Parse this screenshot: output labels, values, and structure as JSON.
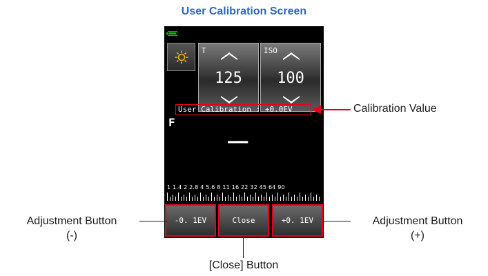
{
  "title": "User Calibration Screen",
  "screen": {
    "param_t": {
      "label": "T",
      "value": "125"
    },
    "param_iso": {
      "label": "ISO",
      "value": "100"
    },
    "calibration_text": "User Calibration : +0.0EV",
    "f_label": "F",
    "reading": "——",
    "f_scale": "1  1.4  2  2.8  4  5.6  8  11  16  22  32  45  64  90",
    "buttons": {
      "minus": "-0. 1EV",
      "close": "Close",
      "plus": "+0. 1EV"
    }
  },
  "annotations": {
    "calibration_value": "Calibration Value",
    "adjust_minus_line1": "Adjustment Button",
    "adjust_minus_line2": "(-)",
    "adjust_plus_line1": "Adjustment Button",
    "adjust_plus_line2": "(+)",
    "close_button": "[Close] Button"
  },
  "icons": {
    "battery": "battery-icon",
    "mode": "sun-icon",
    "increase": "chevron-up-icon",
    "decrease": "chevron-down-icon"
  },
  "colors": {
    "title": "#2a67c6",
    "highlight": "#e8001c",
    "battery": "#00c400"
  }
}
